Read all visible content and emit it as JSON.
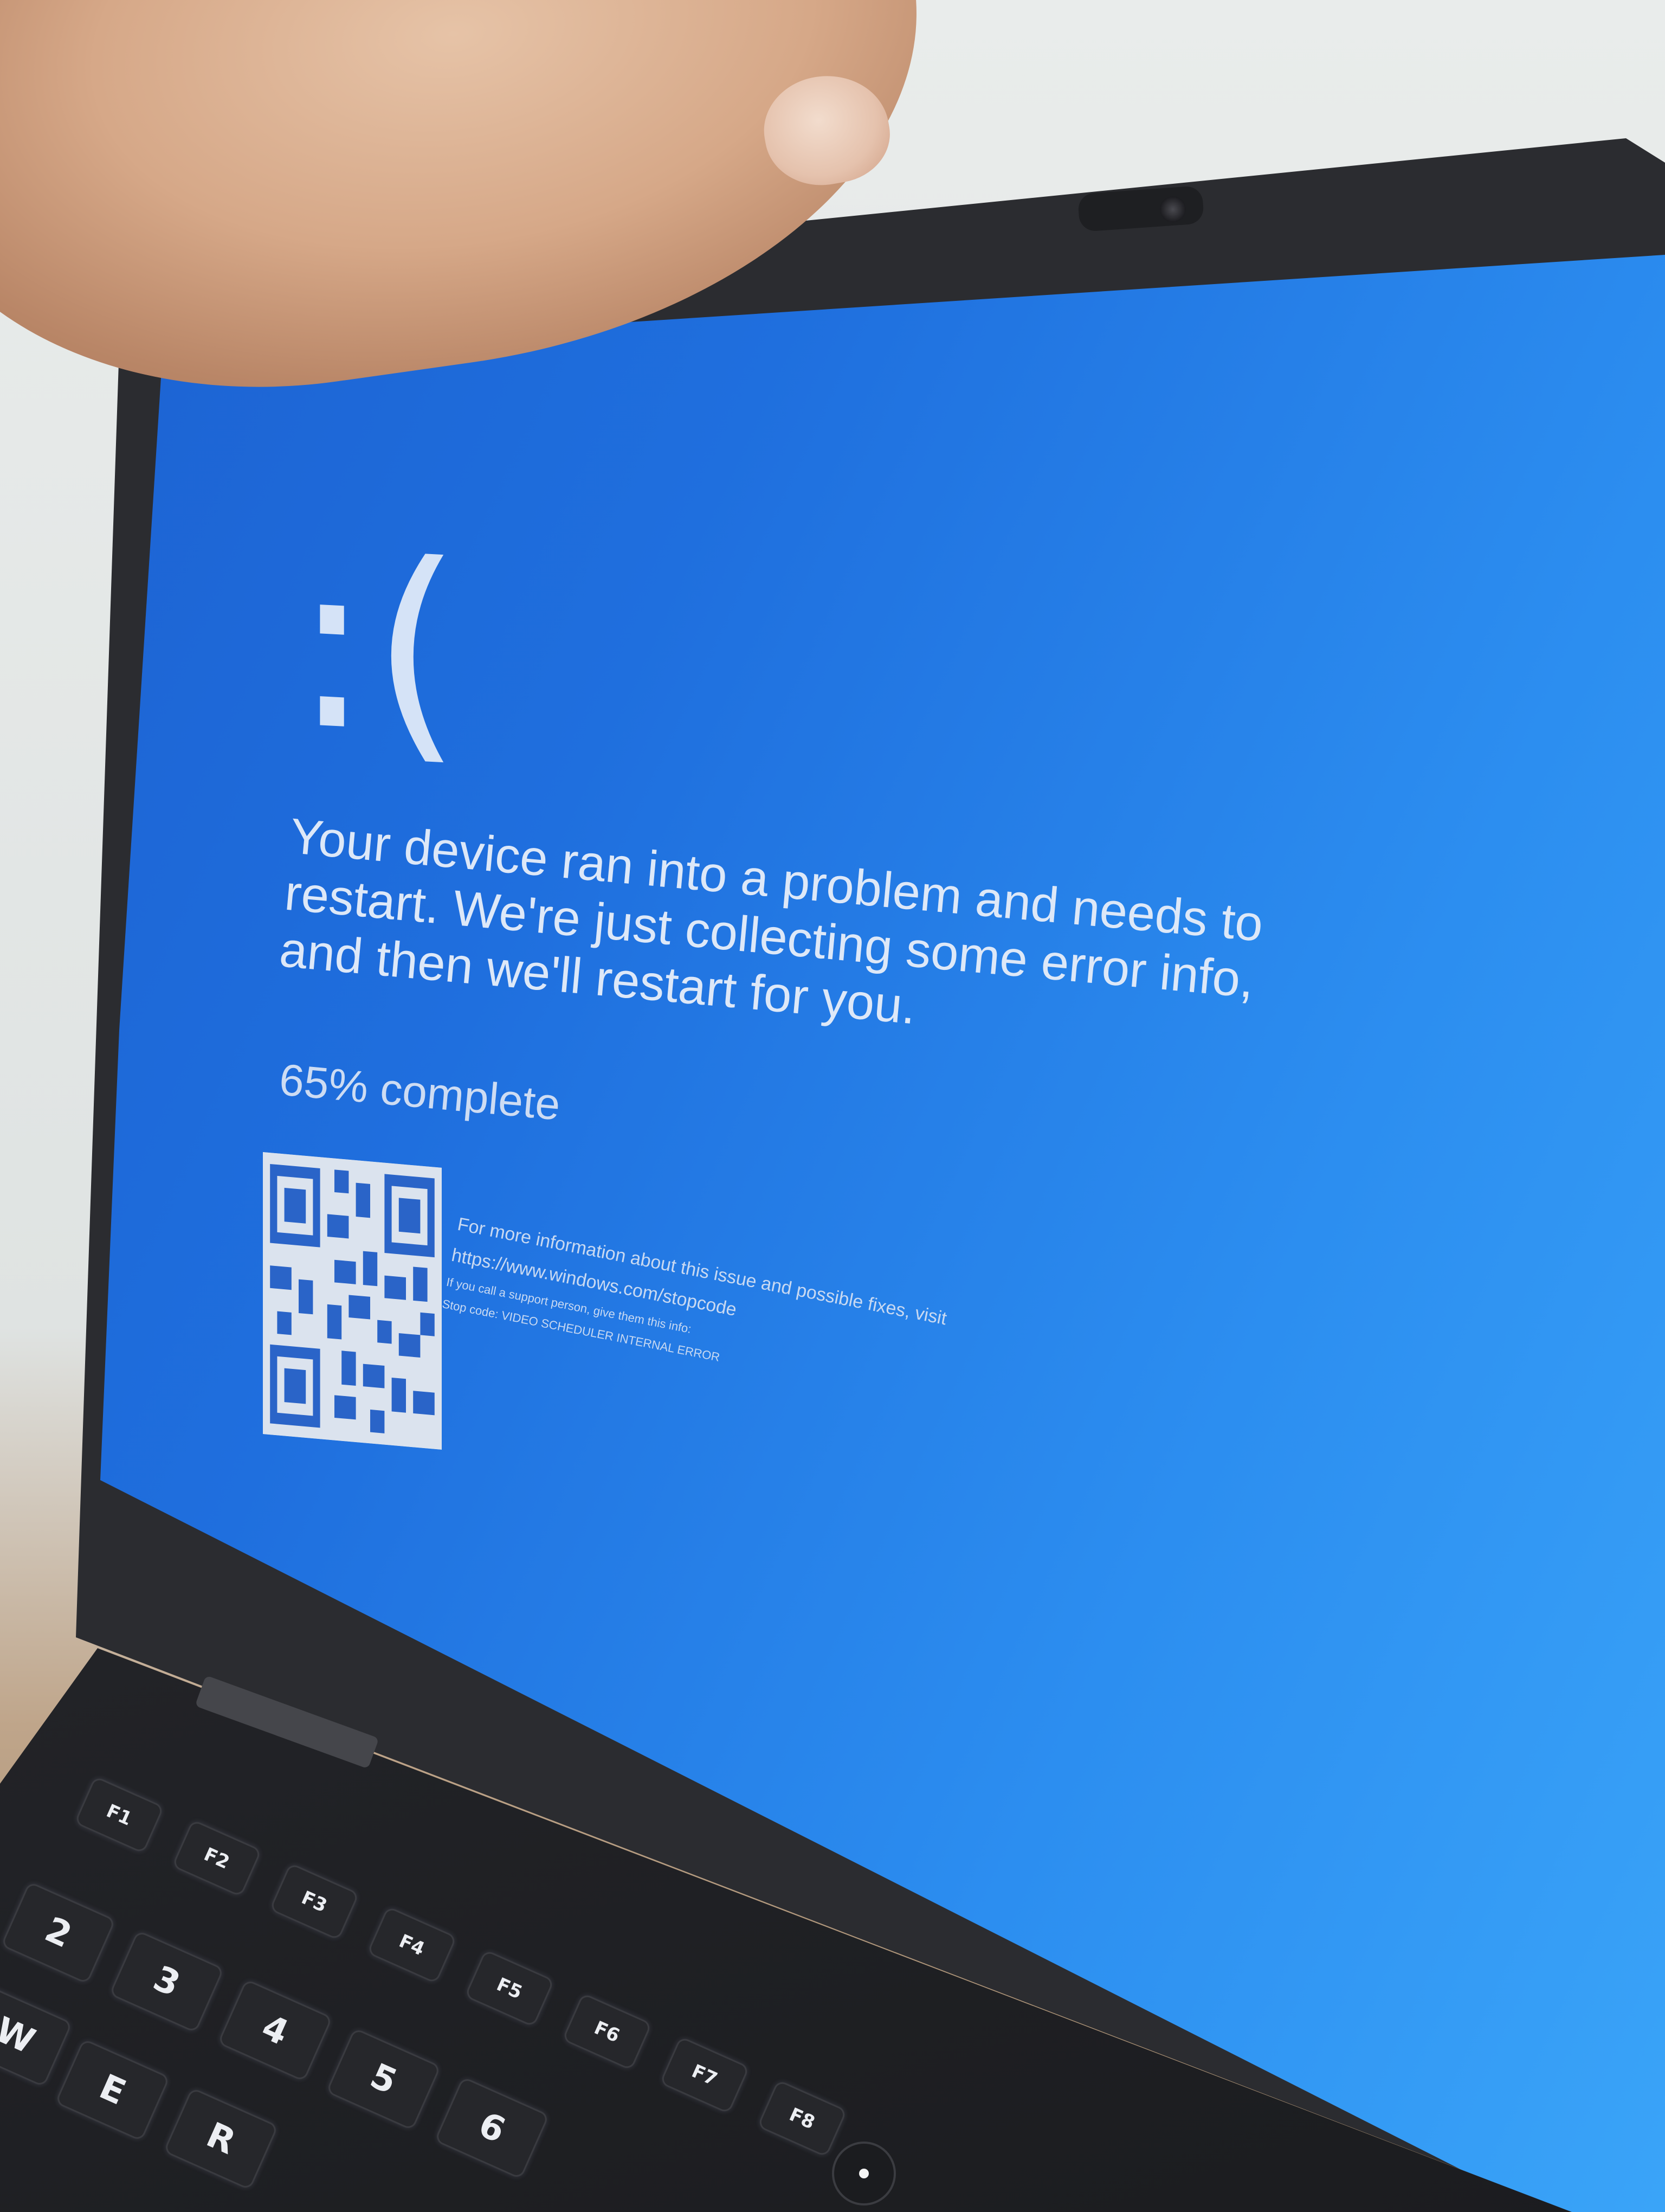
{
  "bsod": {
    "frown": ":(",
    "message": "Your device ran into a problem and needs to restart. We're just collecting some error info, and then we'll restart for you.",
    "progress": "65% complete",
    "info_line_1": "For more information about this issue and possible fixes, visit",
    "info_url": "https://www.windows.com/stopcode",
    "support_line": "If you call a support person, give them this info:",
    "stop_code": "Stop code: VIDEO SCHEDULER INTERNAL ERROR"
  },
  "keyboard": {
    "keys": [
      "2",
      "3",
      "4",
      "5",
      "6",
      "E",
      "R",
      "W"
    ],
    "fn_keys": [
      "F1",
      "F2",
      "F3",
      "F4",
      "F5",
      "F6",
      "F7",
      "F8"
    ]
  },
  "colors": {
    "screen_blue": "#1f6fde",
    "text": "#dde8f8",
    "bezel": "#2b2c30"
  }
}
